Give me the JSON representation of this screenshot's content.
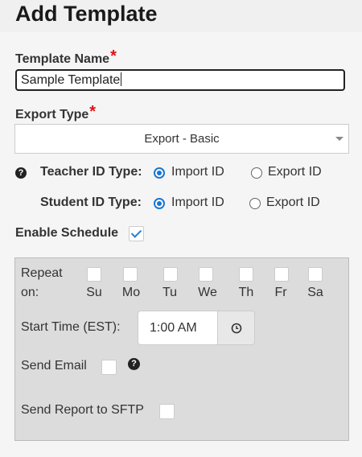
{
  "page": {
    "title": "Add Template"
  },
  "template_name": {
    "label": "Template Name",
    "required_mark": "*",
    "value": "Sample Template"
  },
  "export_type": {
    "label": "Export Type",
    "required_mark": "*",
    "selected": "Export - Basic"
  },
  "teacher_id_type": {
    "label": "Teacher ID Type:",
    "options": [
      "Import ID",
      "Export ID"
    ],
    "selected": "Import ID"
  },
  "student_id_type": {
    "label": "Student ID Type:",
    "options": [
      "Import ID",
      "Export ID"
    ],
    "selected": "Import ID"
  },
  "enable_schedule": {
    "label": "Enable Schedule",
    "checked": true
  },
  "schedule": {
    "repeat_label_1": "Repeat",
    "repeat_label_2": "on:",
    "days": [
      "Su",
      "Mo",
      "Tu",
      "We",
      "Th",
      "Fr",
      "Sa"
    ],
    "start_time_label": "Start Time (EST):",
    "start_time_value": "1:00 AM",
    "send_email_label": "Send Email",
    "send_sftp_label": "Send Report to SFTP"
  },
  "colors": {
    "accent": "#1976d2",
    "required": "#e01010"
  },
  "icons": {
    "help": "question-circle-icon",
    "clock": "clock-icon",
    "dropdown": "caret-down-icon"
  }
}
